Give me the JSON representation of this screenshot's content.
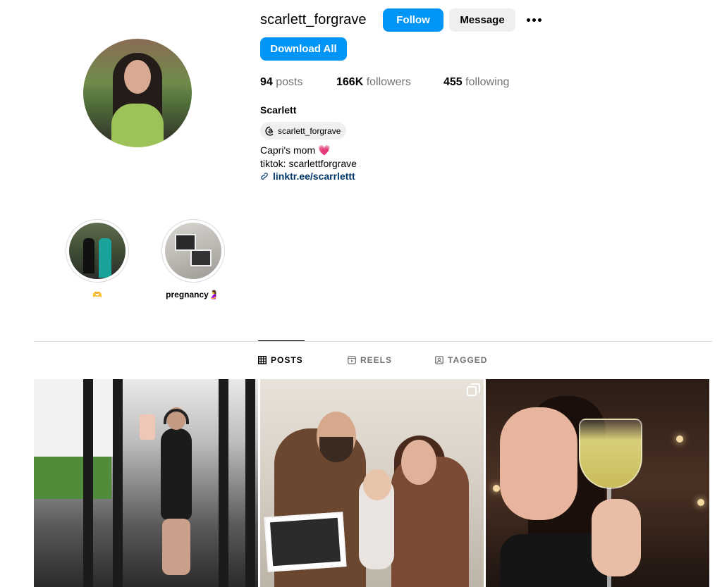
{
  "profile": {
    "username": "scarlett_forgrave",
    "follow_label": "Follow",
    "message_label": "Message",
    "download_label": "Download All",
    "stats": {
      "posts_count": "94",
      "posts_label": "posts",
      "followers_count": "166K",
      "followers_label": "followers",
      "following_count": "455",
      "following_label": "following"
    },
    "full_name": "Scarlett",
    "threads_handle": "scarlett_forgrave",
    "bio_line1": "Capri's mom",
    "bio_emoji": "💗",
    "bio_line2": "tiktok: scarlettforgrave",
    "link": "linktr.ee/scarrlettt"
  },
  "highlights": [
    {
      "label": "🫶"
    },
    {
      "label": "pregnancy🤰"
    }
  ],
  "tabs": [
    {
      "label": "POSTS",
      "icon": "grid-icon",
      "active": true
    },
    {
      "label": "REELS",
      "icon": "reels-icon",
      "active": false
    },
    {
      "label": "TAGGED",
      "icon": "tagged-icon",
      "active": false
    }
  ],
  "colors": {
    "accent": "#0095f6",
    "link": "#00376b",
    "muted": "#737373"
  }
}
